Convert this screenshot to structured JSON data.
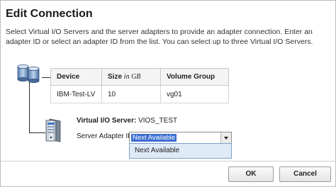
{
  "dialog": {
    "title": "Edit Connection",
    "description": "Select Virtual I/O Servers and the server adapters to provide an adapter connection. Enter an adapter ID or select an adapter ID from the list. You can select up to three Virtual I/O Servers."
  },
  "table": {
    "headers": {
      "device": "Device",
      "size": "Size",
      "size_unit": "in GB",
      "volume_group": "Volume Group"
    },
    "rows": [
      {
        "device": "IBM-Test-LV",
        "size": "10",
        "volume_group": "vg01"
      }
    ]
  },
  "vios": {
    "label": "Virtual I/O Server:",
    "name": "VIOS_TEST"
  },
  "adapter": {
    "label": "Server Adapter ID",
    "selected": "Next Available",
    "options": [
      "Next Available"
    ]
  },
  "buttons": {
    "ok": "OK",
    "cancel": "Cancel"
  },
  "icons": {
    "storage": "database-stack-icon",
    "server": "server-tower-icon"
  }
}
